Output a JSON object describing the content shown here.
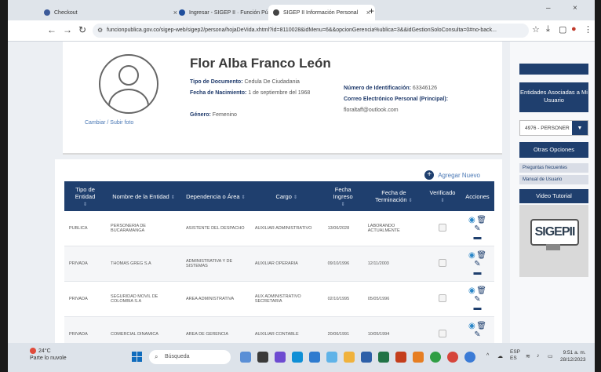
{
  "browser": {
    "tabs": [
      {
        "label": "Checkout"
      },
      {
        "label": "Ingresar - SIGEP II · Función Pú"
      },
      {
        "label": "SIGEP II Información Personal"
      }
    ],
    "url": "funcionpublica.gov.co/sigep-web/sigep2/persona/hojaDeVida.xhtml?id=8110028&idMenu=6&&opcionGerencia%ublica=3&&idGestionSoloConsulta=0#no-back..."
  },
  "profile": {
    "name": "Flor Alba Franco León",
    "change_photo": "Cambiar / Subir foto",
    "doc_type_label": "Tipo de Documento:",
    "doc_type_value": "Cedula De Ciudadania",
    "birth_label": "Fecha de Nacimiento:",
    "birth_value": "1 de septiembre del 1968",
    "gender_label": "Género:",
    "gender_value": "Femenino",
    "id_label": "Número de Identificación:",
    "id_value": "63346126",
    "email_label": "Correo Electrónico Personal (Principal):",
    "email_value": "floraltaff@outlook.com"
  },
  "right_panel": {
    "entities_btn": "Entidades Asociadas a Mi Usuario",
    "select_value": "4976 - PERSONER",
    "other_options": "Otras Opciones",
    "faq": "Preguntas frecuentes",
    "manual": "Manual de Usuario",
    "video": "Video Tutorial",
    "logo_text": "SIGEPII"
  },
  "table": {
    "add_new": "Agregar Nuevo",
    "headers": [
      "Tipo de Entidad",
      "Nombre de la Entidad",
      "Dependencia o Área",
      "Cargo",
      "Fecha Ingreso",
      "Fecha de Terminación",
      "Verificado",
      "Acciones"
    ],
    "rows": [
      [
        "PUBLICA",
        "PERSONERIA DE BUCARAMANGA",
        "ASISTENTE DEL DESPACHO",
        "AUXILIAR ADMINISTRATIVO",
        "13/06/2028",
        "LABORANDO ACTUALMENTE"
      ],
      [
        "PRIVADA",
        "THOMAS GREG S.A",
        "ADMINISTRATIVA Y DE SISTEMAS",
        "AUXILIAR OPERARIA",
        "09/10/1996",
        "12/11/2003"
      ],
      [
        "PRIVADA",
        "SEGURIDAD MOVIL DE COLOMBIA S.A",
        "AREA ADMINISTRATIVA",
        "AUX ADMINISTRATIVO SECRETARIA",
        "02/10/1995",
        "05/05/1996"
      ],
      [
        "PRIVADA",
        "COMERCIAL DINAMICA",
        "AREA DE GERENCIA",
        "AUXILIAR CONTABLE",
        "20/06/1991",
        "10/05/1994"
      ]
    ]
  },
  "taskbar": {
    "temp": "24°C",
    "weather": "Parte lo nuvole",
    "search": "Búsqueda",
    "lang": "ESP",
    "lang2": "ES",
    "time": "9:51 a. m.",
    "date": "28/12/2023"
  }
}
